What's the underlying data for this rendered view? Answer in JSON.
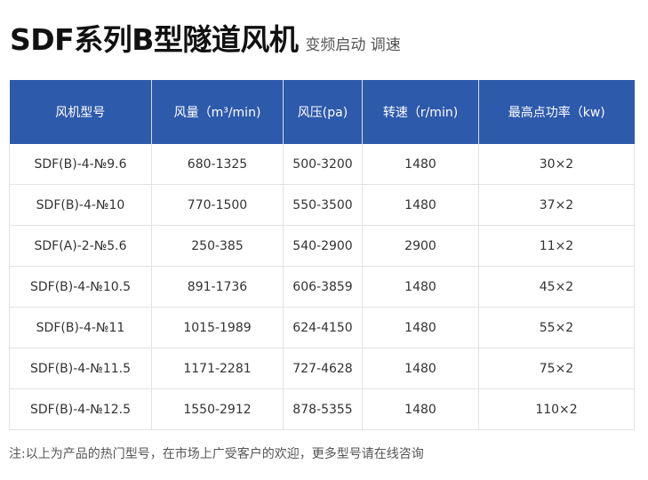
{
  "title": {
    "main": "SDF系列B型隧道风机",
    "sub": "变频启动 调速"
  },
  "table": {
    "headers": [
      "风机型号",
      "风量（m³/min)",
      "风压(pa)",
      "转速（r/min)",
      "最高点功率（kw)"
    ],
    "rows": [
      [
        "SDF(B)-4-№9.6",
        "680-1325",
        "500-3200",
        "1480",
        "30×2"
      ],
      [
        "SDF(B)-4-№10",
        "770-1500",
        "550-3500",
        "1480",
        "37×2"
      ],
      [
        "SDF(A)-2-№5.6",
        "250-385",
        "540-2900",
        "2900",
        "11×2"
      ],
      [
        "SDF(B)-4-№10.5",
        "891-1736",
        "606-3859",
        "1480",
        "45×2"
      ],
      [
        "SDF(B)-4-№11",
        "1015-1989",
        "624-4150",
        "1480",
        "55×2"
      ],
      [
        "SDF(B)-4-№11.5",
        "1171-2281",
        "727-4628",
        "1480",
        "75×2"
      ],
      [
        "SDF(B)-4-№12.5",
        "1550-2912",
        "878-5355",
        "1480",
        "110×2"
      ]
    ]
  },
  "footnote": "注:以上为产品的热门型号，在市场上广受客户的欢迎，更多型号请在线咨询",
  "colors": {
    "header_bg": "#2e5aac",
    "header_text": "#ffffff"
  }
}
